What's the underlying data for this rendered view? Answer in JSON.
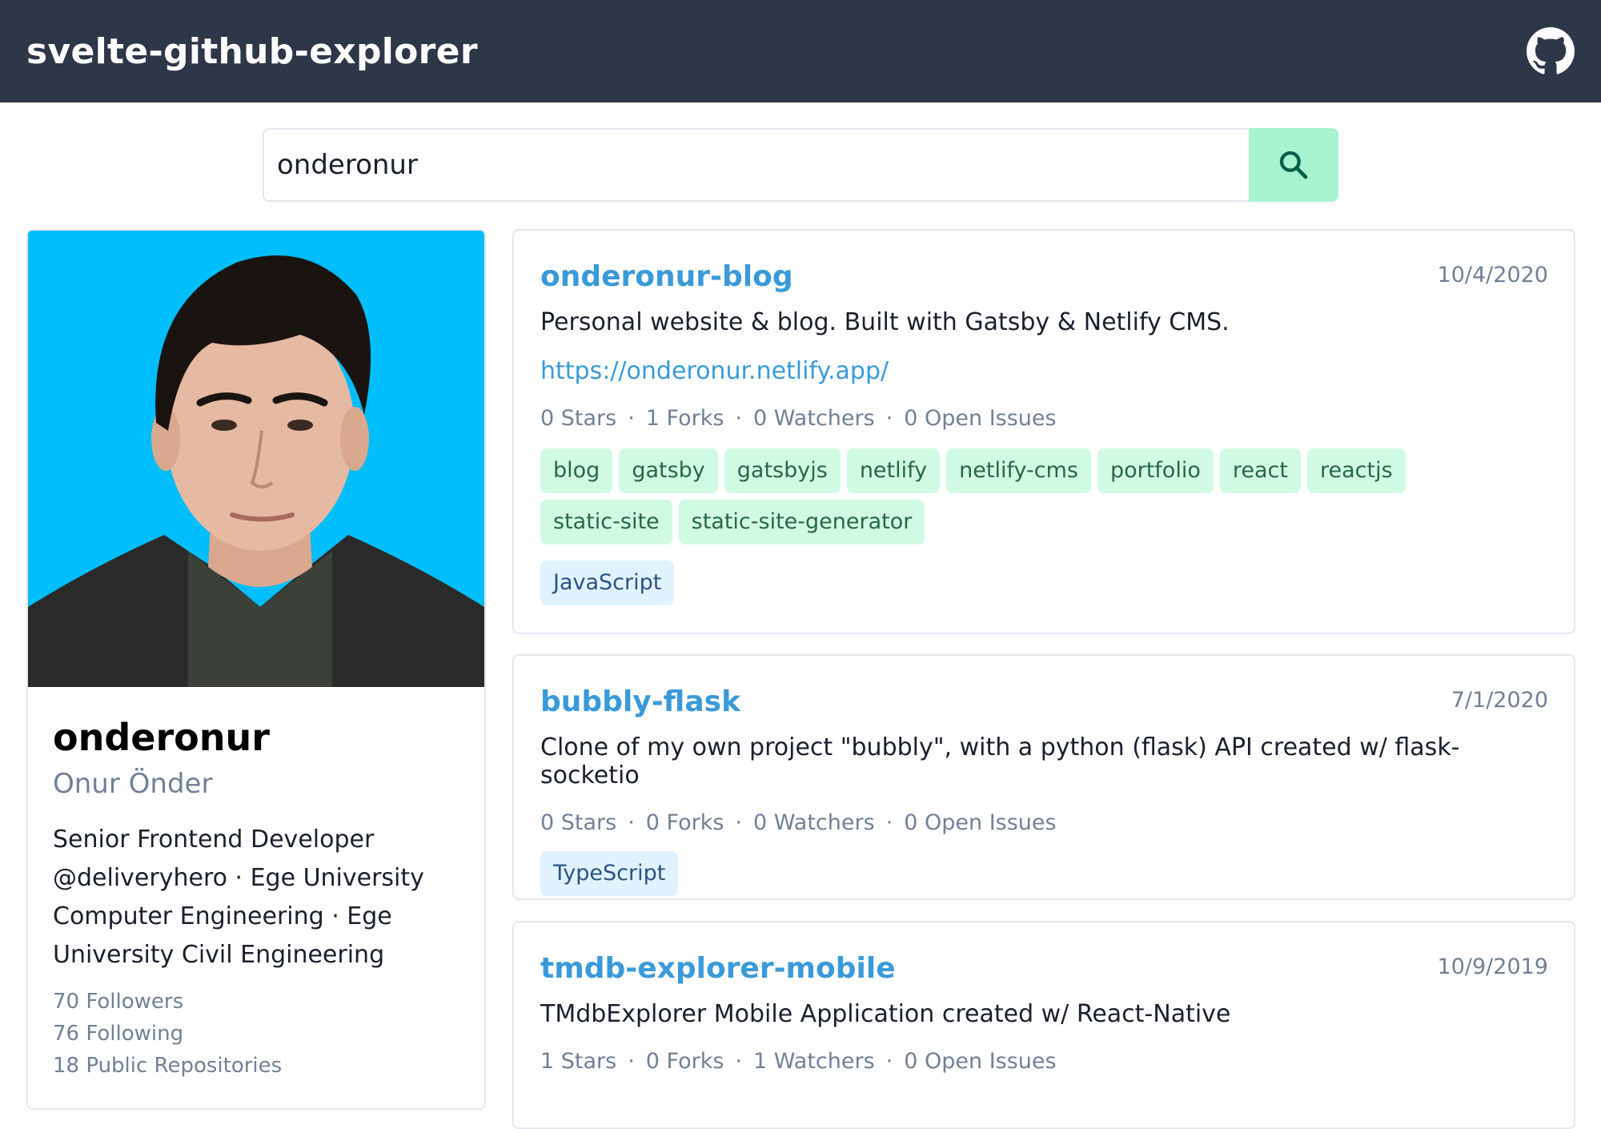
{
  "header": {
    "title": "svelte-github-explorer",
    "github_icon": "github-icon"
  },
  "search": {
    "value": "onderonur",
    "button_icon": "search-icon"
  },
  "profile": {
    "login": "onderonur",
    "name": "Onur Önder",
    "bio": "Senior Frontend Developer @deliveryhero · Ege University Computer Engineering · Ege University Civil Engineering",
    "followers": "70 Followers",
    "following": "76 Following",
    "public_repos": "18 Public Repositories",
    "avatar_bg": "#00bdfb"
  },
  "repos": [
    {
      "name": "onderonur-blog",
      "date": "10/4/2020",
      "description": "Personal website & blog. Built with Gatsby & Netlify CMS.",
      "homepage": "https://onderonur.netlify.app/",
      "stats": {
        "stars": "0 Stars",
        "forks": "1 Forks",
        "watchers": "0 Watchers",
        "issues": "0 Open Issues"
      },
      "topics": [
        "blog",
        "gatsby",
        "gatsbyjs",
        "netlify",
        "netlify-cms",
        "portfolio",
        "react",
        "reactjs",
        "static-site",
        "static-site-generator"
      ],
      "language": "JavaScript"
    },
    {
      "name": "bubbly-flask",
      "date": "7/1/2020",
      "description": "Clone of my own project \"bubbly\", with a python (flask) API created w/ flask-socketio",
      "stats": {
        "stars": "0 Stars",
        "forks": "0 Forks",
        "watchers": "0 Watchers",
        "issues": "0 Open Issues"
      },
      "language": "TypeScript"
    },
    {
      "name": "tmdb-explorer-mobile",
      "date": "10/9/2019",
      "description": "TMdbExplorer Mobile Application created w/ React-Native",
      "stats": {
        "stars": "1 Stars",
        "forks": "0 Forks",
        "watchers": "1 Watchers",
        "issues": "0 Open Issues"
      }
    }
  ],
  "colors": {
    "header_bg": "#2d3748",
    "accent": "#3a9ad9",
    "search_button": "#a7f3d0",
    "topic_bg": "#d1fae5",
    "language_bg": "#e0f2fe"
  }
}
